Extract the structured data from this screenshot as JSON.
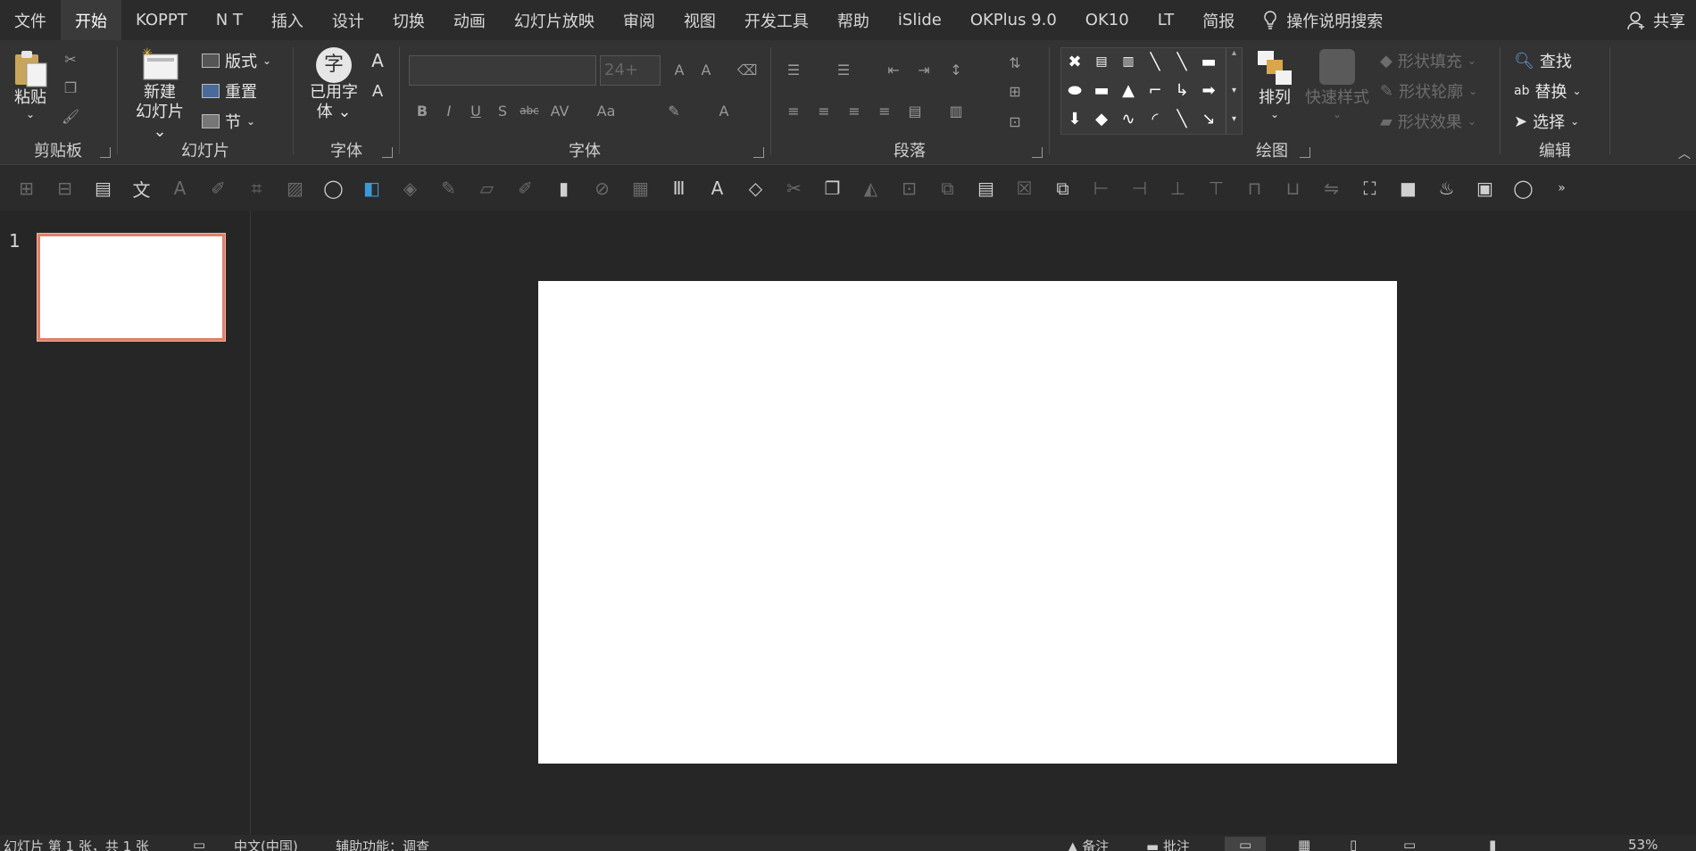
{
  "tabs": [
    "文件",
    "开始",
    "KOPPT",
    "N T",
    "插入",
    "设计",
    "切换",
    "动画",
    "幻灯片放映",
    "审阅",
    "视图",
    "开发工具",
    "帮助",
    "iSlide",
    "OKPlus 9.0",
    "OK10",
    "LT",
    "简报"
  ],
  "active_tab": "开始",
  "tell_me": "操作说明搜索",
  "share": "共享",
  "ribbon": {
    "clipboard": {
      "paste": "粘贴",
      "label": "剪贴板"
    },
    "slides": {
      "new_slide_1": "新建",
      "new_slide_2": "幻灯片",
      "layout": "版式",
      "reset": "重置",
      "section": "节",
      "label": "幻灯片"
    },
    "fonts": {
      "used_font_1": "已用字",
      "used_font_2": "体",
      "glyph": "字",
      "label": "字体"
    },
    "font": {
      "size": "24+",
      "label": "字体"
    },
    "paragraph": {
      "label": "段落"
    },
    "drawing": {
      "arrange": "排列",
      "quick_styles": "快速样式",
      "shape_fill": "形状填充",
      "shape_outline": "形状轮廓",
      "shape_effects": "形状效果",
      "label": "绘图"
    },
    "editing": {
      "find": "查找",
      "replace": "替换",
      "select": "选择",
      "label": "编辑"
    }
  },
  "thumbnail": {
    "number": "1"
  },
  "status": {
    "slide_info": "幻灯片 第 1 张，共 1 张",
    "language": "中文(中国)",
    "accessibility": "辅助功能：调查",
    "notes": "备注",
    "comments": "批注",
    "zoom": "53%"
  },
  "colors": {
    "accent": "#e0806a",
    "ribbon_bg": "#333333",
    "tab_bg": "#2b2b2b",
    "canvas_bg": "#262626"
  }
}
